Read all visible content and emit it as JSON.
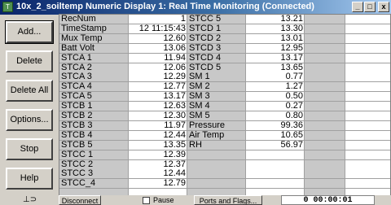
{
  "window": {
    "title": "10x_2_soiltemp Numeric Display 1: Real Time Monitoring (Connected)",
    "app_icon_glyph": "T",
    "minimize_glyph": "_",
    "maximize_glyph": "□",
    "close_glyph": "x"
  },
  "buttons": {
    "add": "Add...",
    "delete": "Delete",
    "delete_all": "Delete All",
    "options": "Options...",
    "stop": "Stop",
    "help": "Help"
  },
  "columns": [
    {
      "rows": [
        {
          "label": "RecNum",
          "value": "1"
        },
        {
          "label": "TimeStamp",
          "value": "12 11:15:43"
        },
        {
          "label": "Mux Temp",
          "value": "12.60"
        },
        {
          "label": "Batt Volt",
          "value": "13.06"
        },
        {
          "label": "STCA 1",
          "value": "11.94"
        },
        {
          "label": "STCA 2",
          "value": "12.06"
        },
        {
          "label": "STCA 3",
          "value": "12.29"
        },
        {
          "label": "STCA 4",
          "value": "12.77"
        },
        {
          "label": "STCA 5",
          "value": "13.17"
        },
        {
          "label": "STCB 1",
          "value": "12.63"
        },
        {
          "label": "STCB 2",
          "value": "12.30"
        },
        {
          "label": "STCB 3",
          "value": "11.97"
        },
        {
          "label": "STCB 4",
          "value": "12.44"
        },
        {
          "label": "STCB 5",
          "value": "13.35"
        },
        {
          "label": "STCC 1",
          "value": "12.39"
        },
        {
          "label": "STCC 2",
          "value": "12.37"
        },
        {
          "label": "STCC 3",
          "value": "12.44"
        },
        {
          "label": "STCC_4",
          "value": "12.79"
        }
      ]
    },
    {
      "rows": [
        {
          "label": "STCC 5",
          "value": "13.21"
        },
        {
          "label": "STCD 1",
          "value": "13.30"
        },
        {
          "label": "STCD 2",
          "value": "13.01"
        },
        {
          "label": "STCD 3",
          "value": "12.95"
        },
        {
          "label": "STCD 4",
          "value": "13.17"
        },
        {
          "label": "STCD 5",
          "value": "13.65"
        },
        {
          "label": "SM 1",
          "value": "0.77"
        },
        {
          "label": "SM 2",
          "value": "1.27"
        },
        {
          "label": "SM 3",
          "value": "0.50"
        },
        {
          "label": "SM 4",
          "value": "0.27"
        },
        {
          "label": "SM 5",
          "value": "0.80"
        },
        {
          "label": "Pressure",
          "value": "99.36"
        },
        {
          "label": "Air Temp",
          "value": "10.65"
        },
        {
          "label": "RH",
          "value": "56.97"
        }
      ]
    }
  ],
  "bottom": {
    "disconnect": "Disconnect",
    "pause": "Pause",
    "ports_flags": "Ports and Flags...",
    "clock": "0 00:00:01"
  }
}
